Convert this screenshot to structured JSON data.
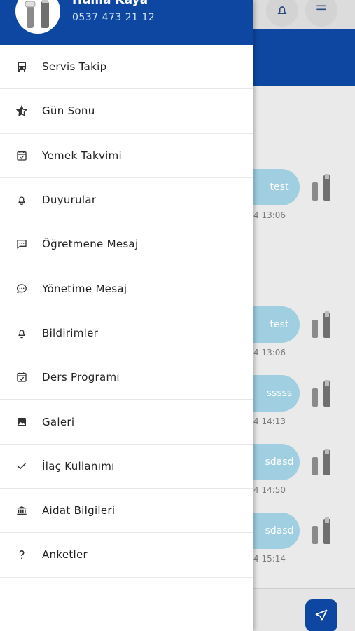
{
  "profile": {
    "name": "Hüma Kaya",
    "phone": "0537 473 21 12"
  },
  "menu": [
    {
      "label": "Servis Takip",
      "icon": "bus-icon"
    },
    {
      "label": "Gün Sonu",
      "icon": "star-half-icon"
    },
    {
      "label": "Yemek Takvimi",
      "icon": "calendar-check-icon"
    },
    {
      "label": "Duyurular",
      "icon": "bell-icon"
    },
    {
      "label": "Öğretmene Mesaj",
      "icon": "message-square-icon"
    },
    {
      "label": "Yönetime Mesaj",
      "icon": "message-circle-icon"
    },
    {
      "label": "Bildirimler",
      "icon": "bell-icon"
    },
    {
      "label": "Ders Programı",
      "icon": "calendar-check-icon"
    },
    {
      "label": "Galeri",
      "icon": "image-icon"
    },
    {
      "label": "İlaç Kullanımı",
      "icon": "check-icon"
    },
    {
      "label": "Aidat Bilgileri",
      "icon": "bank-icon"
    },
    {
      "label": "Anketler",
      "icon": "question-icon"
    }
  ],
  "chat": {
    "messages": [
      {
        "text": "test",
        "time": "4 13:06"
      },
      {
        "text": "test",
        "time": "4 13:06"
      },
      {
        "text": "sssss",
        "time": "4 14:13"
      },
      {
        "text": "sdasd",
        "time": "4 14:50"
      },
      {
        "text": "sdasd",
        "time": "4 15:14"
      }
    ]
  },
  "colors": {
    "primary": "#0d47a1",
    "bubble": "#29b6f6",
    "overlay": "rgba(0,0,0,0.38)"
  }
}
